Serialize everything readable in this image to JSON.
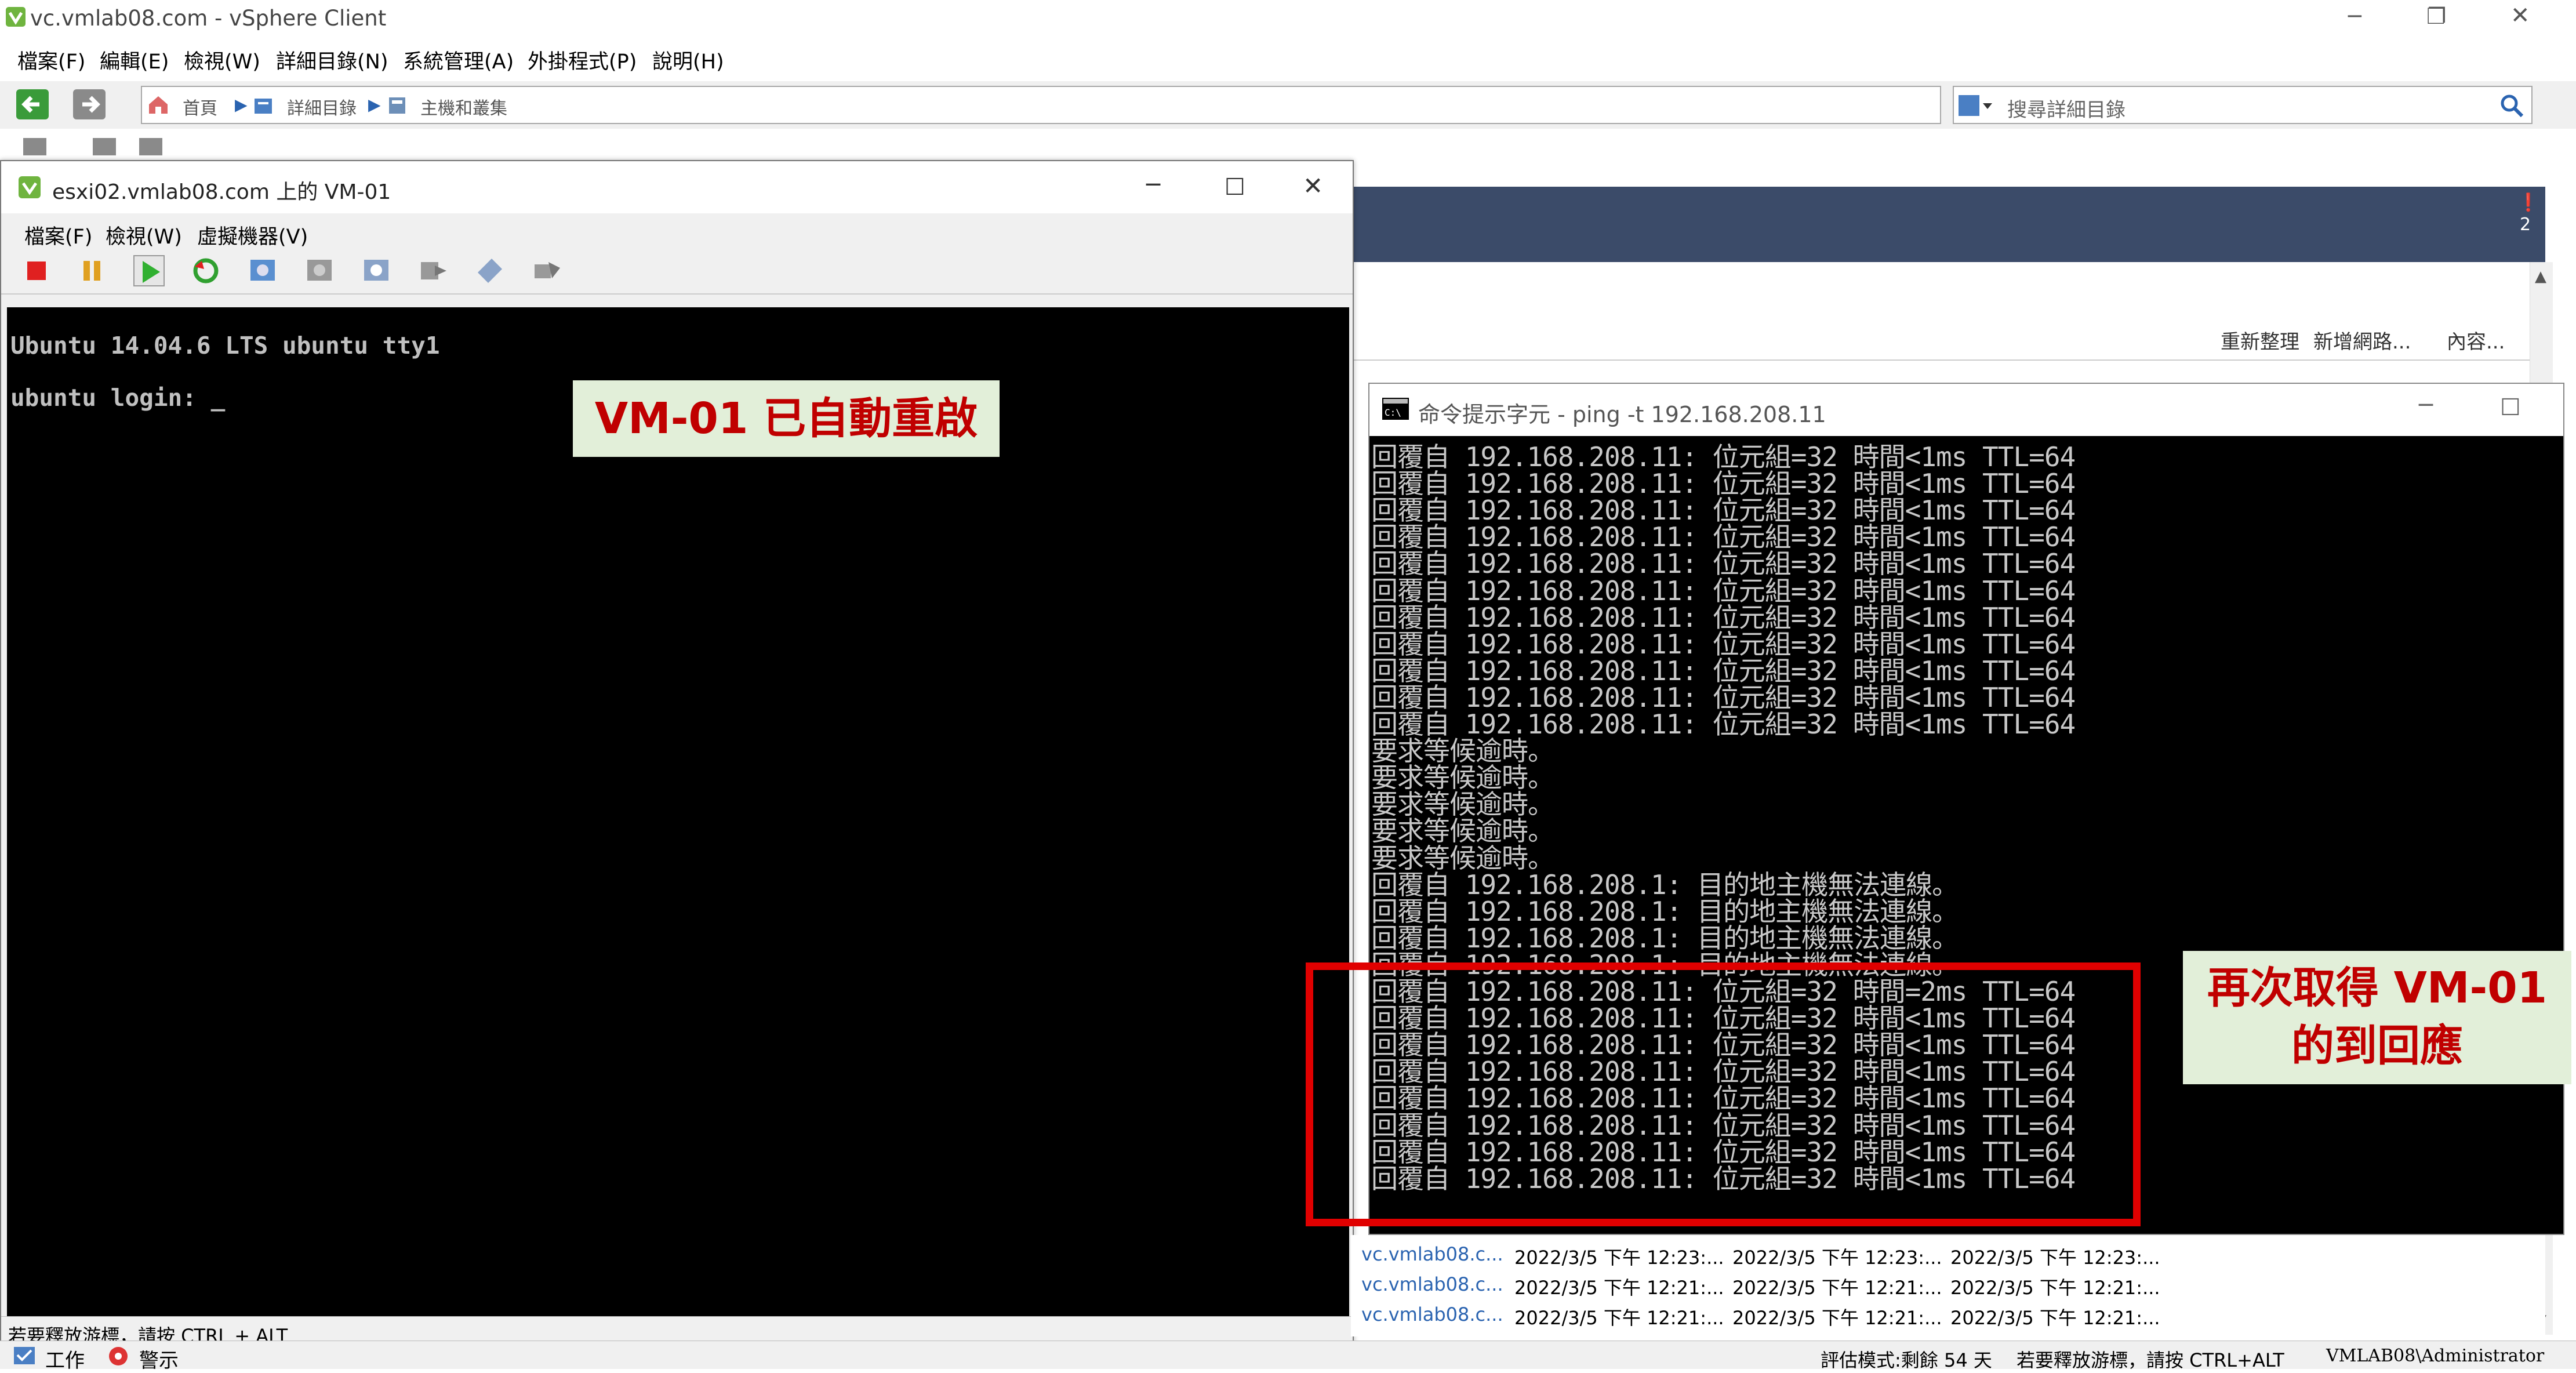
{
  "main_window": {
    "title": "vc.vmlab08.com - vSphere Client",
    "menu": [
      "檔案(F)",
      "編輯(E)",
      "檢視(W)",
      "詳細目錄(N)",
      "系統管理(A)",
      "外掛程式(P)",
      "說明(H)"
    ],
    "breadcrumb": [
      "首頁",
      "詳細目錄",
      "主機和叢集"
    ],
    "search_placeholder": "搜尋詳細目錄",
    "alarm_count": "2",
    "actions": [
      "重新整理",
      "新增網路...",
      "內容..."
    ]
  },
  "vm_console": {
    "title": "esxi02.vmlab08.com 上的 VM-01",
    "menu": [
      "檔案(F)",
      "檢視(W)",
      "虛擬機器(V)"
    ],
    "lines": [
      "Ubuntu 14.04.6 LTS ubuntu tty1",
      "ubuntu login: _"
    ],
    "status": "若要釋放游標，請按 CTRL + ALT"
  },
  "cmd_window": {
    "title": "命令提示字元 - ping  -t 192.168.208.11",
    "lines": [
      "回覆自 192.168.208.11: 位元組=32 時間<1ms TTL=64",
      "回覆自 192.168.208.11: 位元組=32 時間<1ms TTL=64",
      "回覆自 192.168.208.11: 位元組=32 時間<1ms TTL=64",
      "回覆自 192.168.208.11: 位元組=32 時間<1ms TTL=64",
      "回覆自 192.168.208.11: 位元組=32 時間<1ms TTL=64",
      "回覆自 192.168.208.11: 位元組=32 時間<1ms TTL=64",
      "回覆自 192.168.208.11: 位元組=32 時間<1ms TTL=64",
      "回覆自 192.168.208.11: 位元組=32 時間<1ms TTL=64",
      "回覆自 192.168.208.11: 位元組=32 時間<1ms TTL=64",
      "回覆自 192.168.208.11: 位元組=32 時間<1ms TTL=64",
      "回覆自 192.168.208.11: 位元組=32 時間<1ms TTL=64",
      "要求等候逾時。",
      "要求等候逾時。",
      "要求等候逾時。",
      "要求等候逾時。",
      "要求等候逾時。",
      "回覆自 192.168.208.1: 目的地主機無法連線。",
      "回覆自 192.168.208.1: 目的地主機無法連線。",
      "回覆自 192.168.208.1: 目的地主機無法連線。",
      "回覆自 192.168.208.1: 目的地主機無法連線。",
      "回覆自 192.168.208.11: 位元組=32 時間=2ms TTL=64",
      "回覆自 192.168.208.11: 位元組=32 時間<1ms TTL=64",
      "回覆自 192.168.208.11: 位元組=32 時間<1ms TTL=64",
      "回覆自 192.168.208.11: 位元組=32 時間<1ms TTL=64",
      "回覆自 192.168.208.11: 位元組=32 時間<1ms TTL=64",
      "回覆自 192.168.208.11: 位元組=32 時間<1ms TTL=64",
      "回覆自 192.168.208.11: 位元組=32 時間<1ms TTL=64",
      "回覆自 192.168.208.11: 位元組=32 時間<1ms TTL=64"
    ]
  },
  "tasks": [
    {
      "name": "vc.vmlab08.c...",
      "t1": "2022/3/5 下午 12:23:...",
      "t2": "2022/3/5 下午 12:23:...",
      "t3": "2022/3/5 下午 12:23:..."
    },
    {
      "name": "vc.vmlab08.c...",
      "t1": "2022/3/5 下午 12:21:...",
      "t2": "2022/3/5 下午 12:21:...",
      "t3": "2022/3/5 下午 12:21:..."
    },
    {
      "name": "vc.vmlab08.c...",
      "t1": "2022/3/5 下午 12:21:...",
      "t2": "2022/3/5 下午 12:21:...",
      "t3": "2022/3/5 下午 12:21:..."
    }
  ],
  "statusbar": {
    "tasks": "工作",
    "alarms": "警示",
    "eval": "評估模式:剩餘 54 天",
    "release": "若要釋放游標，請按 CTRL+ALT",
    "user": "VMLAB08\\Administrator"
  },
  "annotations": {
    "reboot": "VM-01 已自動重啟",
    "reply_line1": "再次取得 VM-01",
    "reply_line2": "的到回應"
  },
  "colors": {
    "accent_red": "#e00000",
    "callout_bg": "#e2efd9",
    "callout_text": "#c00000",
    "vsphere_band": "#3b4b69"
  }
}
